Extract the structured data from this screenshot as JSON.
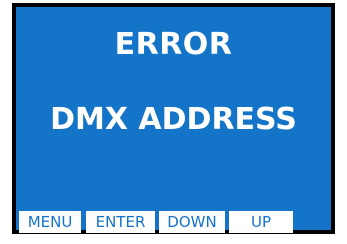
{
  "screen": {
    "title": "ERROR",
    "message": "DMX ADDRESS",
    "background_color": "#1474c8",
    "text_color": "#ffffff"
  },
  "softkeys": {
    "menu": "MENU",
    "enter": "ENTER",
    "down": "DOWN",
    "up": "UP"
  }
}
